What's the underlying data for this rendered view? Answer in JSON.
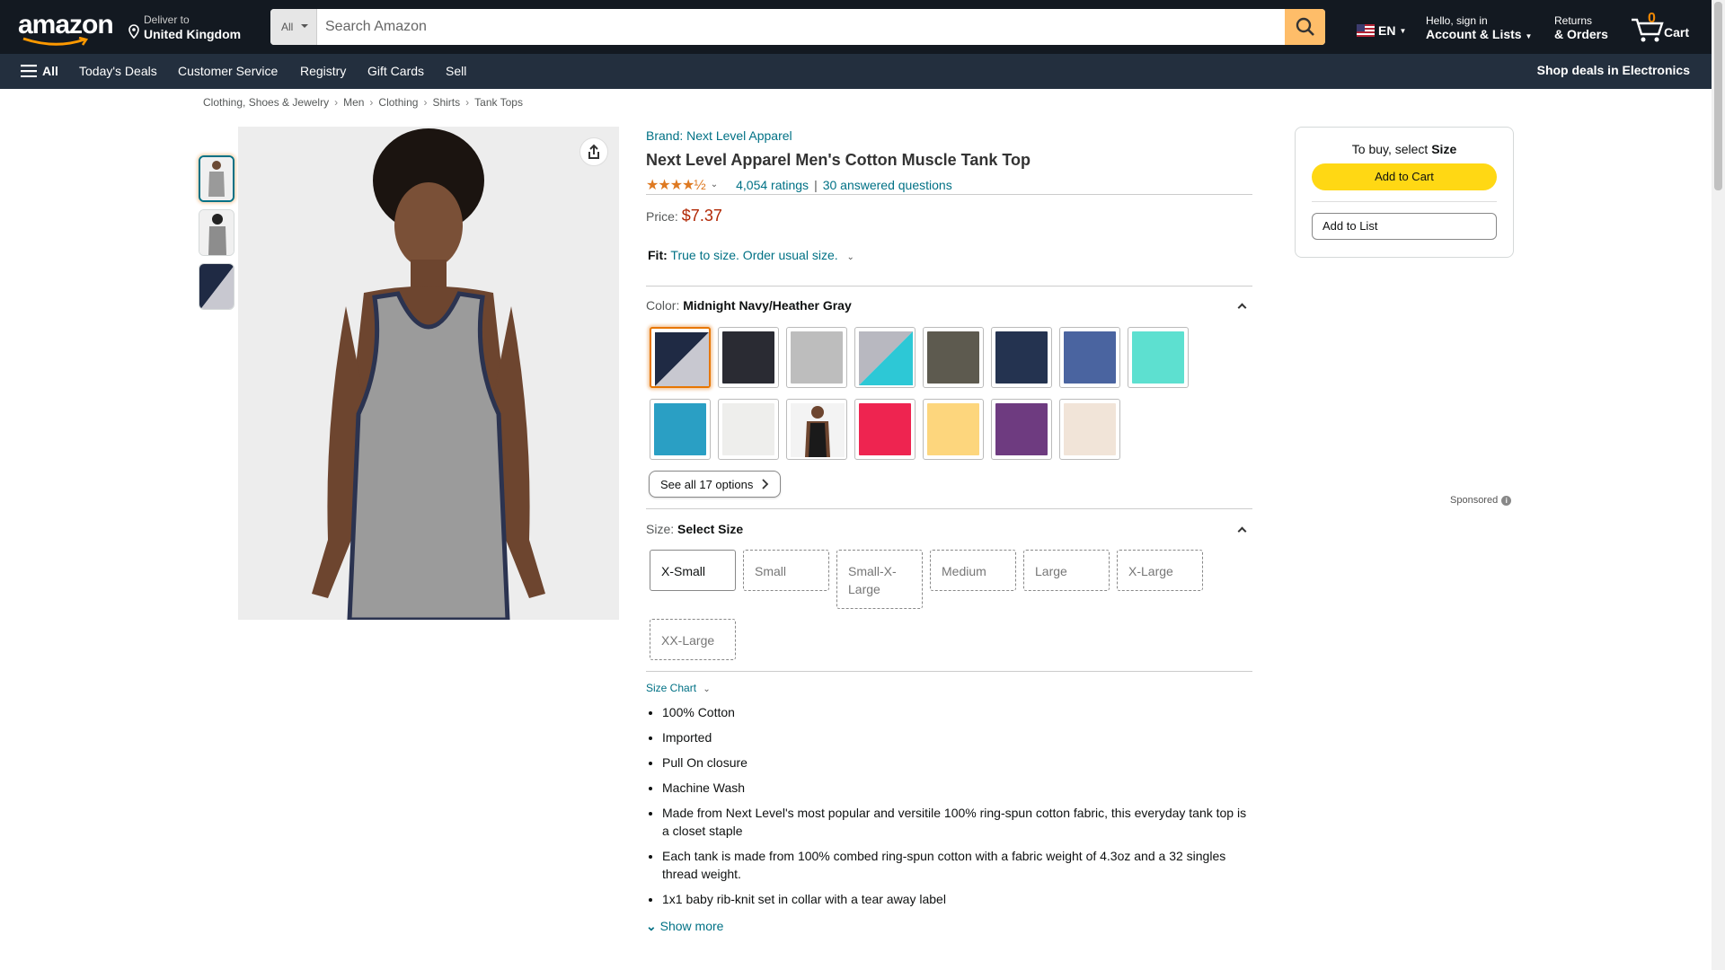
{
  "header": {
    "logo": "amazon",
    "deliver_line1": "Deliver to",
    "deliver_line2": "United Kingdom",
    "search_category": "All",
    "search_placeholder": "Search Amazon",
    "language": "EN",
    "account_line1": "Hello, sign in",
    "account_line2": "Account & Lists",
    "returns_line1": "Returns",
    "returns_line2": "& Orders",
    "cart_count": "0",
    "cart_label": "Cart"
  },
  "subnav": {
    "all": "All",
    "items": [
      "Today's Deals",
      "Customer Service",
      "Registry",
      "Gift Cards",
      "Sell"
    ],
    "promo": "Shop deals in Electronics"
  },
  "breadcrumb": [
    "Clothing, Shoes & Jewelry",
    "Men",
    "Clothing",
    "Shirts",
    "Tank Tops"
  ],
  "product": {
    "brand": "Brand: Next Level Apparel",
    "title": "Next Level Apparel Men's Cotton Muscle Tank Top",
    "stars": "★★★★½",
    "rating": 4.5,
    "ratings_count": "4,054 ratings",
    "questions": "30 answered questions",
    "price_label": "Price:",
    "price": "$7.37",
    "fit_label": "Fit:",
    "fit_value": "True to size. Order usual size.",
    "color_label": "Color:",
    "color_value": "Midnight Navy/Heather Gray",
    "see_all": "See all 17 options",
    "size_label": "Size:",
    "size_value": "Select Size",
    "sizes": [
      "X-Small",
      "Small",
      "Small-X-Large",
      "Medium",
      "Large",
      "X-Large",
      "XX-Large"
    ],
    "size_chart": "Size Chart",
    "bullets": [
      "100% Cotton",
      "Imported",
      "Pull On closure",
      "Machine Wash",
      "Made from Next Level's most popular and versitile 100% ring-spun cotton fabric, this everyday tank top is a closet staple",
      "Each tank is made from 100% combed ring-spun cotton with a fabric weight of 4.3oz and a 32 singles thread weight.",
      "1x1 baby rib-knit set in collar with a tear away label"
    ],
    "show_more": "Show more"
  },
  "swatch_colors": [
    "#2a3550",
    "#2a2b33",
    "#bdbdbd",
    "#2dc8d6",
    "#5d5a4f",
    "#243350",
    "#4a64a0",
    "#5de0d0",
    "#2a9fc4",
    "#eeeeec",
    "#1a1a1a",
    "#ee2450",
    "#fdd67d",
    "#6e3b80",
    "#f1e4d8"
  ],
  "buybox": {
    "prompt": "To buy, select",
    "prompt_bold": "Size",
    "add_to_cart": "Add to Cart",
    "add_to_list": "Add to List"
  },
  "sponsored": "Sponsored"
}
